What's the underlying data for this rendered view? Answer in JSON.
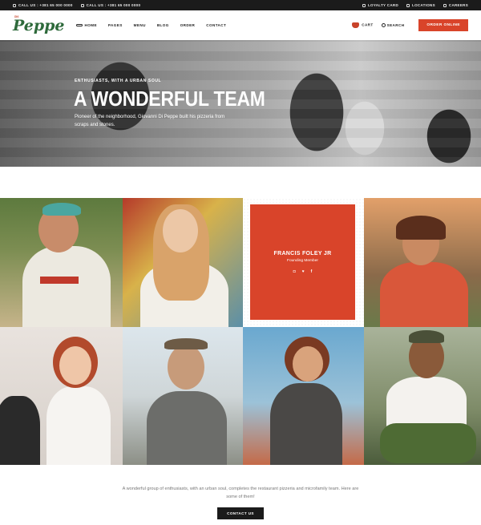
{
  "topbar": {
    "call1": "CALL US : +381 65 000 0000",
    "call2": "CALL US : +381 65 000 0000",
    "loyalty": "LOYALTY CARD",
    "locations": "LOCATIONS",
    "careers": "CAREERS"
  },
  "header": {
    "logo_small": "Di",
    "logo": "Peppe",
    "nav": [
      "HOME",
      "PAGES",
      "MENU",
      "BLOG",
      "ORDER",
      "CONTACT"
    ],
    "cart_label": "CART",
    "search_label": "SEARCH",
    "order_button": "ORDER ONLINE"
  },
  "hero": {
    "eyebrow": "ENTHUSIASTS, WITH A URBAN SOUL",
    "title": "A WONDERFUL TEAM",
    "description": "Pioneer of the neighborhood, Giovanni Di Peppe built his pizzeria from scraps and stones."
  },
  "team_card": {
    "name": "FRANCIS FOLEY JR",
    "role": "Founding Member",
    "socials": [
      "instagram-icon",
      "twitter-icon",
      "facebook-icon"
    ],
    "social_glyphs": [
      "◘",
      "♥",
      "f"
    ]
  },
  "footer": {
    "text": "A wonderful group of enthusiasts, with an urban soul, completes the restaurant pizzeria and microfamily team. Here are some of them!",
    "button": "CONTACT US"
  },
  "colors": {
    "accent": "#d9442a",
    "brand_green": "#2e6a3b",
    "topbar": "#1b1b1b"
  }
}
